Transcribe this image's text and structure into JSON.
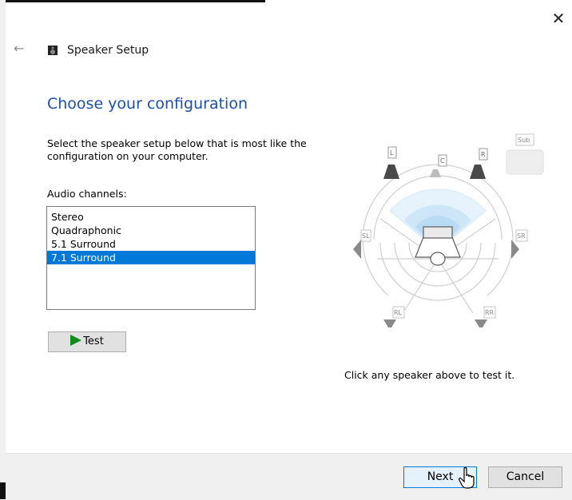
{
  "window": {
    "title": "Speaker Setup",
    "close_glyph": "✕",
    "back_glyph": "←"
  },
  "page": {
    "heading": "Choose your configuration",
    "description": "Select the speaker setup below that is most like the configuration on your computer.",
    "channels_label": "Audio channels:"
  },
  "channels": {
    "options": [
      "Stereo",
      "Quadraphonic",
      "5.1 Surround",
      "7.1 Surround"
    ],
    "selected": "7.1 Surround"
  },
  "test_button": {
    "label": "Test"
  },
  "diagram": {
    "speaker_labels": {
      "L": "L",
      "C": "C",
      "R": "R",
      "SL": "SL",
      "SR": "SR",
      "RL": "RL",
      "RR": "RR",
      "Sub": "Sub"
    }
  },
  "hint": "Click any speaker above to test it.",
  "footer": {
    "next_label": "Next",
    "cancel_label": "Cancel"
  },
  "colors": {
    "accent": "#0078d7",
    "heading": "#1e4fa8",
    "play": "#118a1e",
    "sound_wave": "#cde7f9"
  }
}
